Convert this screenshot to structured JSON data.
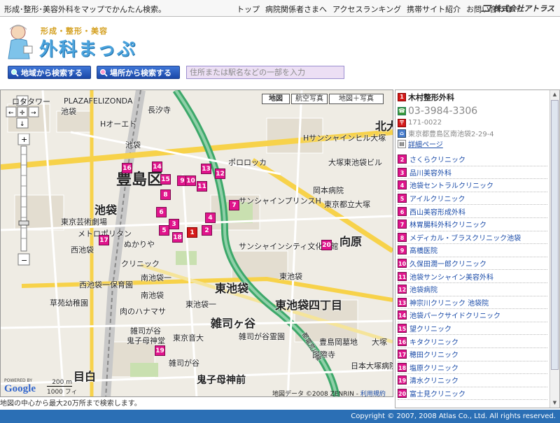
{
  "top": {
    "tagline": "形成･整形･美容外科をマップでかんたん検索。",
    "nav": [
      "トップ",
      "病院関係者さまへ",
      "アクセスランキング",
      "携帯サイト紹介",
      "お問い合わせ"
    ],
    "company": "株式会社アトラス"
  },
  "logo": {
    "sub": "形成・整形・美容",
    "main": "外科まっぷ"
  },
  "search": {
    "area_button": "地域から検索する",
    "place_button": "場所から検索する",
    "placeholder": "住所または駅名などの一部を入力"
  },
  "map": {
    "map_types": [
      "地図",
      "航空写真",
      "地図＋写真"
    ],
    "labels": [
      "池袋",
      "Hオーエド",
      "PLAZAFELIZONDA",
      "長汐寺",
      "池袋",
      "豊島区",
      "池袋",
      "西池袋",
      "東京芸術劇場",
      "メトロポリタン",
      "ぬかりや",
      "クリニック",
      "サンシャインプリンスH",
      "サンシャインシティ文化会館",
      "向原",
      "東池袋",
      "東池袋四丁目",
      "雑司ヶ谷",
      "鬼子母神前",
      "目白",
      "南池袋",
      "西池袋一保育園",
      "草苑幼稚園",
      "肉のハナマサ",
      "雑司が谷",
      "鬼子母神堂",
      "北大",
      "大塚",
      "豊島岡墓地",
      "日本大塚病院",
      "国際寺",
      "ロタタワー",
      "ポロロッカ",
      "Hサンシャインヒル大塚",
      "大塚東池袋ビル",
      "岡本病院",
      "東京都立大塚",
      "東京音大",
      "雑司が谷霊園",
      "東池袋",
      "南池袋一",
      "雑司が谷",
      "都電荒川線",
      "東池袋一"
    ],
    "pins": [
      "1",
      "2",
      "3",
      "4",
      "5",
      "6",
      "7",
      "8",
      "9",
      "10",
      "11",
      "12",
      "13",
      "14",
      "15",
      "16",
      "17",
      "18",
      "19",
      "20"
    ],
    "scale_m": "200 m",
    "scale_ft": "1000 フィート",
    "google_powered": "POWERED BY",
    "google": "Google",
    "attribution": "地図データ ©2008 ZENRIN -",
    "attribution_link": "利用規約"
  },
  "footnote": "地図の中心から最大20万所まで検索します。",
  "footer": "Copyright © 2007, 2008 Atlas Co., Ltd. All rights reserved.",
  "detail": {
    "name": "木村整形外科",
    "tel": "03-3984-3306",
    "zip": "171-0022",
    "address": "東京都豊島区南池袋2-29-4",
    "link": "詳細ページ"
  },
  "clinics": [
    {
      "num": "2",
      "name": "さくらクリニック"
    },
    {
      "num": "3",
      "name": "品川美容外科"
    },
    {
      "num": "4",
      "name": "池袋セントラルクリニック"
    },
    {
      "num": "5",
      "name": "アイルクリニック"
    },
    {
      "num": "6",
      "name": "西山美容形成外科"
    },
    {
      "num": "7",
      "name": "林胃腸科外科クリニック"
    },
    {
      "num": "8",
      "name": "メディカル・ブラスクリニック池袋"
    },
    {
      "num": "9",
      "name": "高橋医院"
    },
    {
      "num": "10",
      "name": "久保田潤一郎クリニック"
    },
    {
      "num": "11",
      "name": "池袋サンシャイン美容外科"
    },
    {
      "num": "12",
      "name": "池袋病院"
    },
    {
      "num": "13",
      "name": "神宗川クリニック 池袋院"
    },
    {
      "num": "14",
      "name": "池袋パークサイドクリニック"
    },
    {
      "num": "15",
      "name": "望クリニック"
    },
    {
      "num": "16",
      "name": "キタクリニック"
    },
    {
      "num": "17",
      "name": "穂田クリニック"
    },
    {
      "num": "18",
      "name": "塩原クリニック"
    },
    {
      "num": "19",
      "name": "清水クリニック"
    },
    {
      "num": "20",
      "name": "富士見クリニック"
    }
  ],
  "colors": {
    "footer": "#2b6fb5",
    "pin": "#e0148c",
    "button": "#1b48a8"
  }
}
